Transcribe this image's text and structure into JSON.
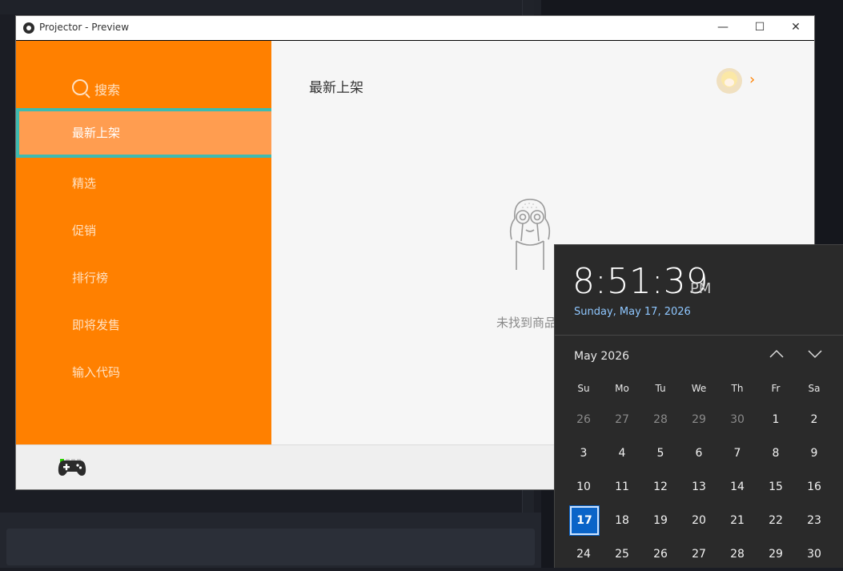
{
  "window": {
    "title": "Projector - Preview",
    "minimize_glyph": "—",
    "maximize_glyph": "☐",
    "close_glyph": "✕"
  },
  "sidebar": {
    "search_label": "搜索",
    "items": [
      {
        "label": "最新上架",
        "active": true
      },
      {
        "label": "精选"
      },
      {
        "label": "促销"
      },
      {
        "label": "排行榜"
      },
      {
        "label": "即将发售"
      },
      {
        "label": "输入代码"
      }
    ],
    "accent": "#ff8000",
    "active_border": "#3ebbb0"
  },
  "main": {
    "title": "最新上架",
    "empty_text": "未找到商品"
  },
  "calendar": {
    "time": "8:51:39",
    "ampm": "PM",
    "date_long": "Sunday, May 17, 2026",
    "month_label": "May 2026",
    "weekdays": [
      "Su",
      "Mo",
      "Tu",
      "We",
      "Th",
      "Fr",
      "Sa"
    ],
    "weeks": [
      [
        "26",
        "27",
        "28",
        "29",
        "30",
        "1",
        "2"
      ],
      [
        "3",
        "4",
        "5",
        "6",
        "7",
        "8",
        "9"
      ],
      [
        "10",
        "11",
        "12",
        "13",
        "14",
        "15",
        "16"
      ],
      [
        "17",
        "18",
        "19",
        "20",
        "21",
        "22",
        "23"
      ],
      [
        "24",
        "25",
        "26",
        "27",
        "28",
        "29",
        "30"
      ]
    ],
    "dim_first_week_count": 5,
    "today": "17",
    "today_color": "#0a64c8"
  }
}
